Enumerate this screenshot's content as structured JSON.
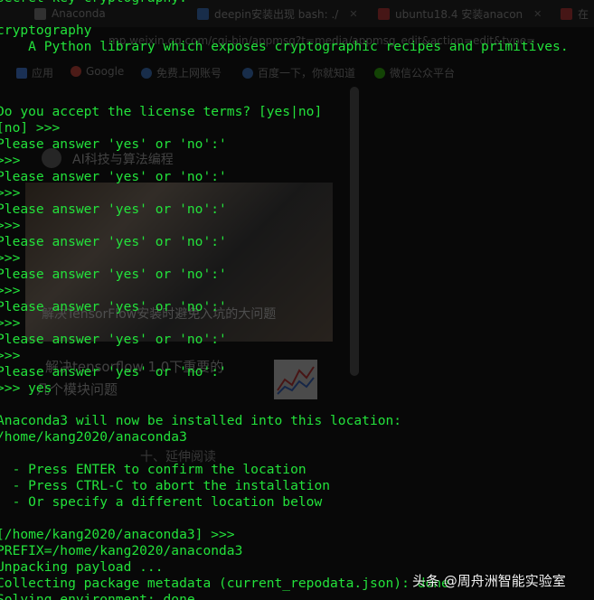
{
  "background_browser": {
    "tabs": [
      {
        "label": "Anaconda",
        "icon": "document-icon",
        "icon_color": "#888888"
      },
      {
        "label": "deepin安装出现 bash: ./",
        "icon": "paw-icon",
        "icon_color": "#3a7bd5"
      },
      {
        "label": "ubuntu18.4 安装anacon",
        "icon": "csdn-icon",
        "icon_color": "#c83434"
      },
      {
        "label": "在",
        "icon": "csdn-icon",
        "icon_color": "#c83434"
      }
    ],
    "address": "mp.weixin.qq.com/cgi-bin/appmsg?t=media/appmsg_edit&action=edit&type=",
    "bookmarks": [
      {
        "label": "应用",
        "icon": "apps-icon",
        "icon_color": "#4285f4"
      },
      {
        "label": "Google",
        "icon": "google-icon",
        "icon_color": "#db4437"
      },
      {
        "label": "免费上网账号",
        "icon": "paw-icon",
        "icon_color": "#3a7bd5"
      },
      {
        "label": "百度一下，你就知道",
        "icon": "paw-icon",
        "icon_color": "#3a7bd5"
      },
      {
        "label": "微信公众平台",
        "icon": "wechat-icon",
        "icon_color": "#2dc100"
      }
    ],
    "article_author": "AI科技与算法编程",
    "article_image_caption": "解决TensorFlow安装时避免入坑的大问题",
    "article_link_line1": "解决tensorflow 1.0下重要的",
    "article_link_line2": "几个模块问题",
    "section_heading": "十、延伸阅读"
  },
  "terminal": {
    "text_color": "#23e23b",
    "lines": [
      "secret-key cryptography.",
      "",
      "cryptography",
      "    A Python library which exposes cryptographic recipes and primitives.",
      "",
      "",
      "",
      "Do you accept the license terms? [yes|no]",
      "[no] >>>",
      "Please answer 'yes' or 'no':'",
      ">>>",
      "Please answer 'yes' or 'no':'",
      ">>>",
      "Please answer 'yes' or 'no':'",
      ">>>",
      "Please answer 'yes' or 'no':'",
      ">>>",
      "Please answer 'yes' or 'no':'",
      ">>>",
      "Please answer 'yes' or 'no':'",
      ">>>",
      "Please answer 'yes' or 'no':'",
      ">>>",
      "Please answer 'yes' or 'no':'",
      ">>> yes",
      "",
      "Anaconda3 will now be installed into this location:",
      "/home/kang2020/anaconda3",
      "",
      "  - Press ENTER to confirm the location",
      "  - Press CTRL-C to abort the installation",
      "  - Or specify a different location below",
      "",
      "[/home/kang2020/anaconda3] >>>",
      "PREFIX=/home/kang2020/anaconda3",
      "Unpacking payload ...",
      "Collecting package metadata (current_repodata.json): done",
      "Solving environment: done"
    ]
  },
  "watermark": "头条 @周舟洲智能实验室"
}
